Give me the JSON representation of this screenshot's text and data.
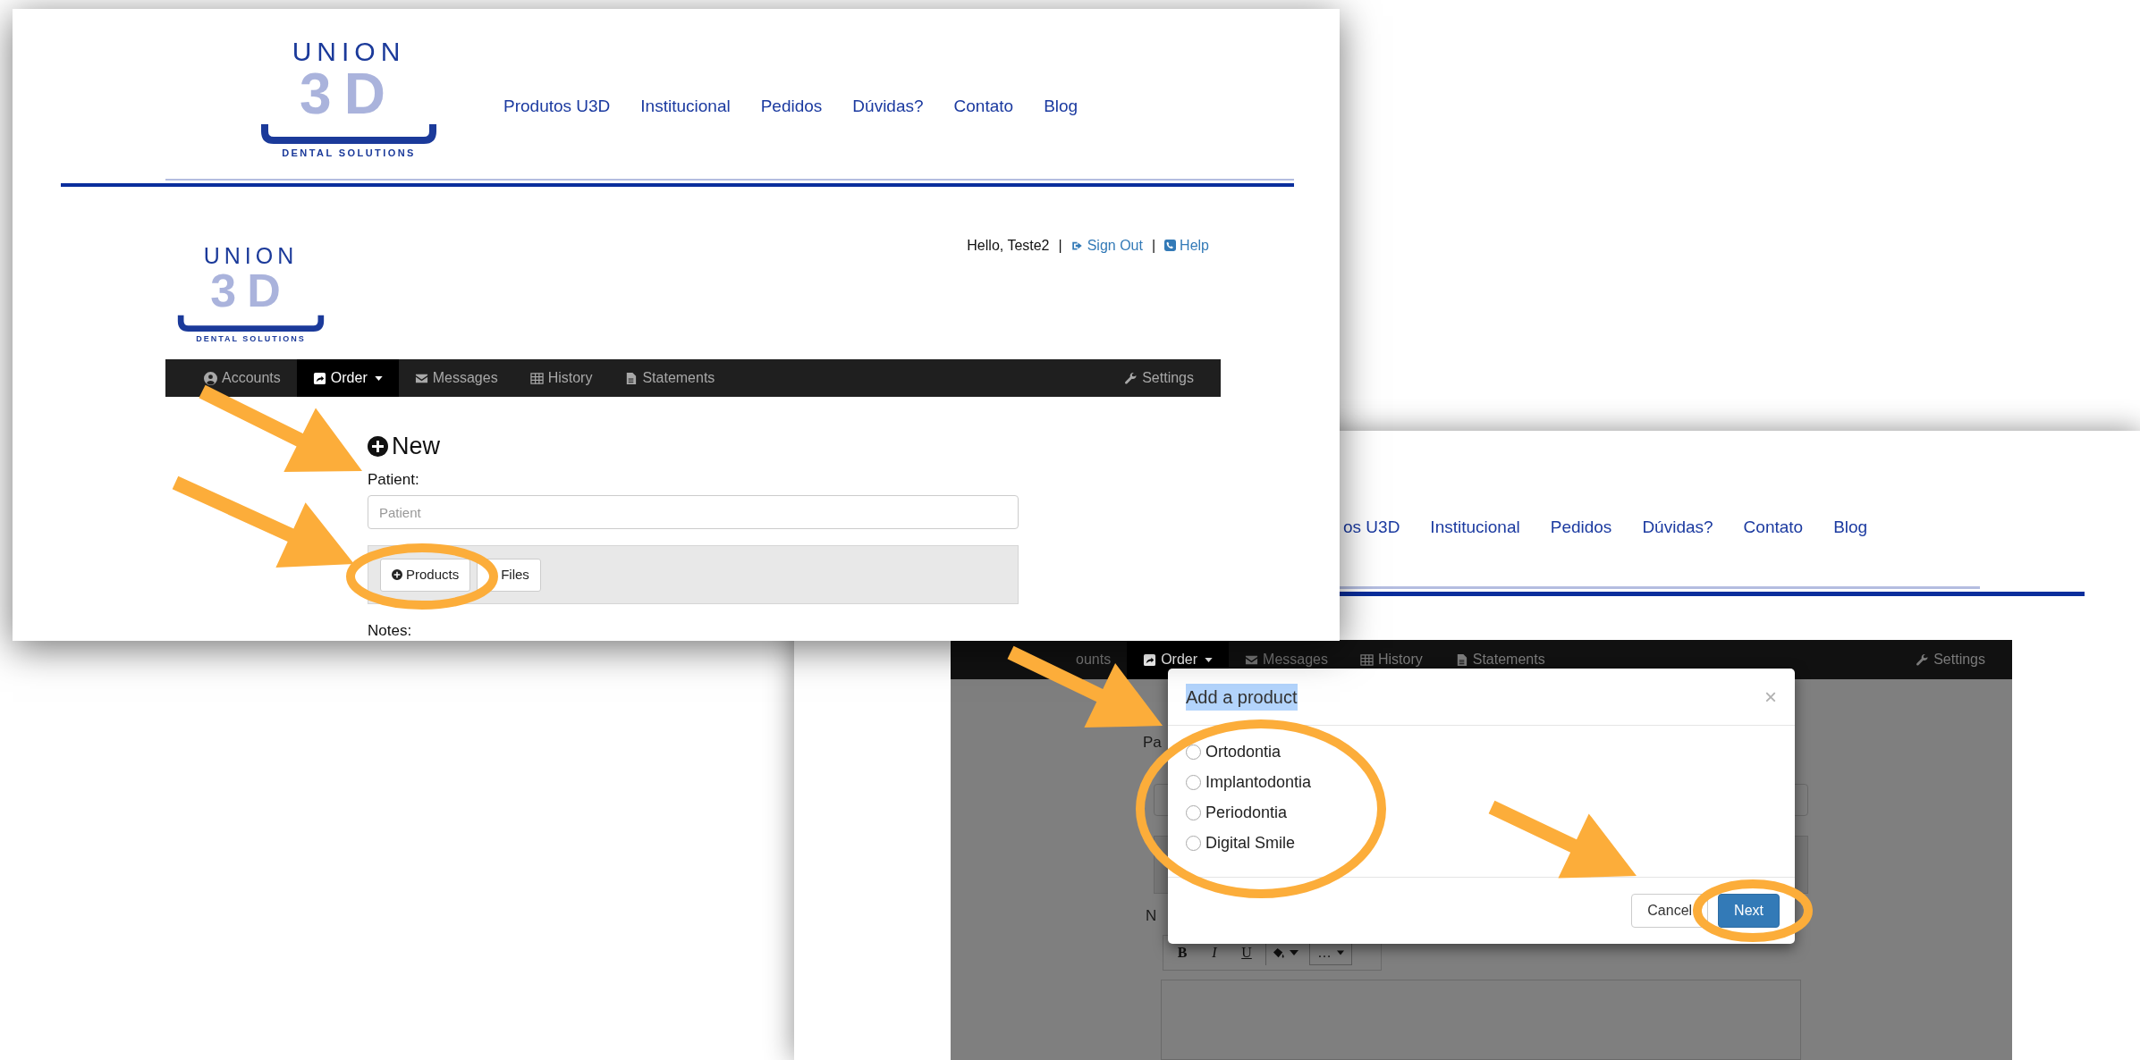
{
  "front_window": {
    "site_logo": {
      "wordmark": "UNION",
      "mark": "3D",
      "tagline": "DENTAL SOLUTIONS"
    },
    "site_nav": [
      "Produtos U3D",
      "Institucional",
      "Pedidos",
      "Dúvidas?",
      "Contato",
      "Blog"
    ],
    "portal_logo": {
      "wordmark": "UNION",
      "mark": "3D",
      "tagline": "DENTAL SOLUTIONS"
    },
    "user_bar": {
      "greeting": "Hello, Teste2",
      "separators": [
        "|",
        "|"
      ],
      "sign_out": "Sign Out",
      "help": "Help"
    },
    "tabs": [
      {
        "label": "Accounts",
        "selected": false,
        "dropdown": false
      },
      {
        "label": "Order",
        "selected": true,
        "dropdown": true
      },
      {
        "label": "Messages",
        "selected": false,
        "dropdown": false
      },
      {
        "label": "History",
        "selected": false,
        "dropdown": false
      },
      {
        "label": "Statements",
        "selected": false,
        "dropdown": false
      },
      {
        "label": "Settings",
        "selected": false,
        "dropdown": false
      }
    ],
    "form": {
      "heading": "New",
      "patient_label": "Patient:",
      "patient_placeholder": "Patient",
      "attach_buttons": [
        "Products",
        "Files"
      ],
      "notes_label": "Notes:"
    }
  },
  "back_window": {
    "site_nav": [
      "os U3D",
      "Institucional",
      "Pedidos",
      "Dúvidas?",
      "Contato",
      "Blog"
    ],
    "tabs": [
      {
        "label": "ounts",
        "selected": false,
        "dropdown": false
      },
      {
        "label": "Order",
        "selected": true,
        "dropdown": true
      },
      {
        "label": "Messages",
        "selected": false,
        "dropdown": false
      },
      {
        "label": "History",
        "selected": false,
        "dropdown": false
      },
      {
        "label": "Statements",
        "selected": false,
        "dropdown": false
      },
      {
        "label": "Settings",
        "selected": false,
        "dropdown": false
      }
    ],
    "form": {
      "patient_label": "Pa",
      "notes_label": "N",
      "editor_toolbar": [
        "B",
        "I",
        "U",
        "…"
      ]
    },
    "modal": {
      "title": "Add a product",
      "title_highlighted": true,
      "close": "×",
      "options": [
        {
          "label": "Ortodontia",
          "selected": false
        },
        {
          "label": "Implantodontia",
          "selected": false
        },
        {
          "label": "Periodontia",
          "selected": false
        },
        {
          "label": "Digital Smile",
          "selected": false
        }
      ],
      "buttons": [
        {
          "label": "Cancel",
          "primary": false
        },
        {
          "label": "Next",
          "primary": true
        }
      ]
    }
  }
}
